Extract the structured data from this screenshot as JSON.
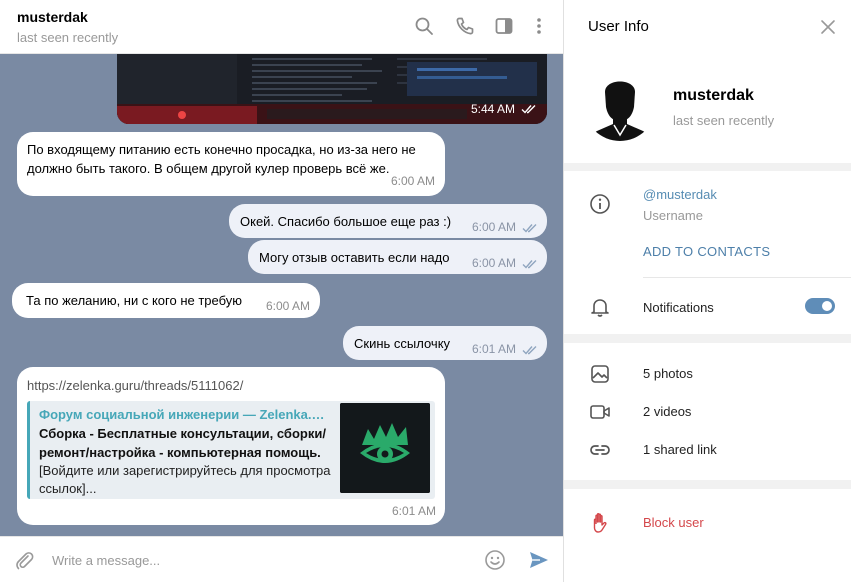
{
  "chat": {
    "contact_name": "musterdak",
    "contact_status": "last seen recently",
    "image_message": {
      "time": "5:44 AM"
    },
    "messages": [
      {
        "direction": "in",
        "text": "По входящему питанию есть конечно просадка, но из-за него не должно быть такого. В общем другой кулер проверь всё же.",
        "time": "6:00 AM"
      },
      {
        "direction": "out",
        "text": "Окей. Спасибо большое еще раз :)",
        "time": "6:00 AM"
      },
      {
        "direction": "out",
        "text": "Могу отзыв оставить если надо",
        "time": "6:00 AM"
      },
      {
        "direction": "in",
        "text": "Та по желанию, ни с кого не требую",
        "time": "6:00 AM"
      },
      {
        "direction": "out",
        "text": "Скинь ссылочку",
        "time": "6:01 AM"
      }
    ],
    "link_message": {
      "url": "https://zelenka.guru/threads/5111062/",
      "preview_site": "Форум социальной инженерии — Zelenka.guru",
      "preview_title": "Сборка - Бесплатные консультации, сборки/ремонт/настройка - компьютерная помощь.",
      "preview_description": "[Войдите или зарегистрируйтесь для просмотра ссылок]...",
      "time": "6:01 AM"
    },
    "composer": {
      "placeholder": "Write a message..."
    },
    "icons": {
      "header": [
        "search-icon",
        "phone-icon",
        "sidebar-toggle-icon",
        "more-vertical-icon"
      ],
      "composer": [
        "attach-icon",
        "emoji-icon",
        "send-icon"
      ]
    }
  },
  "info": {
    "title": "User Info",
    "name": "musterdak",
    "status": "last seen recently",
    "username": "@musterdak",
    "username_label": "Username",
    "add_to_contacts": "ADD TO CONTACTS",
    "notifications_label": "Notifications",
    "notifications_enabled": true,
    "media": {
      "photos": "5 photos",
      "videos": "2 videos",
      "links": "1 shared link"
    },
    "block_label": "Block user"
  },
  "colors": {
    "chat_background": "#7a8aa3",
    "outgoing_bubble": "#eef1f8",
    "accent": "#4d7fa9",
    "link_preview_accent": "#46a7b8",
    "danger": "#d4474b",
    "toggle_on": "#5f8db8"
  }
}
